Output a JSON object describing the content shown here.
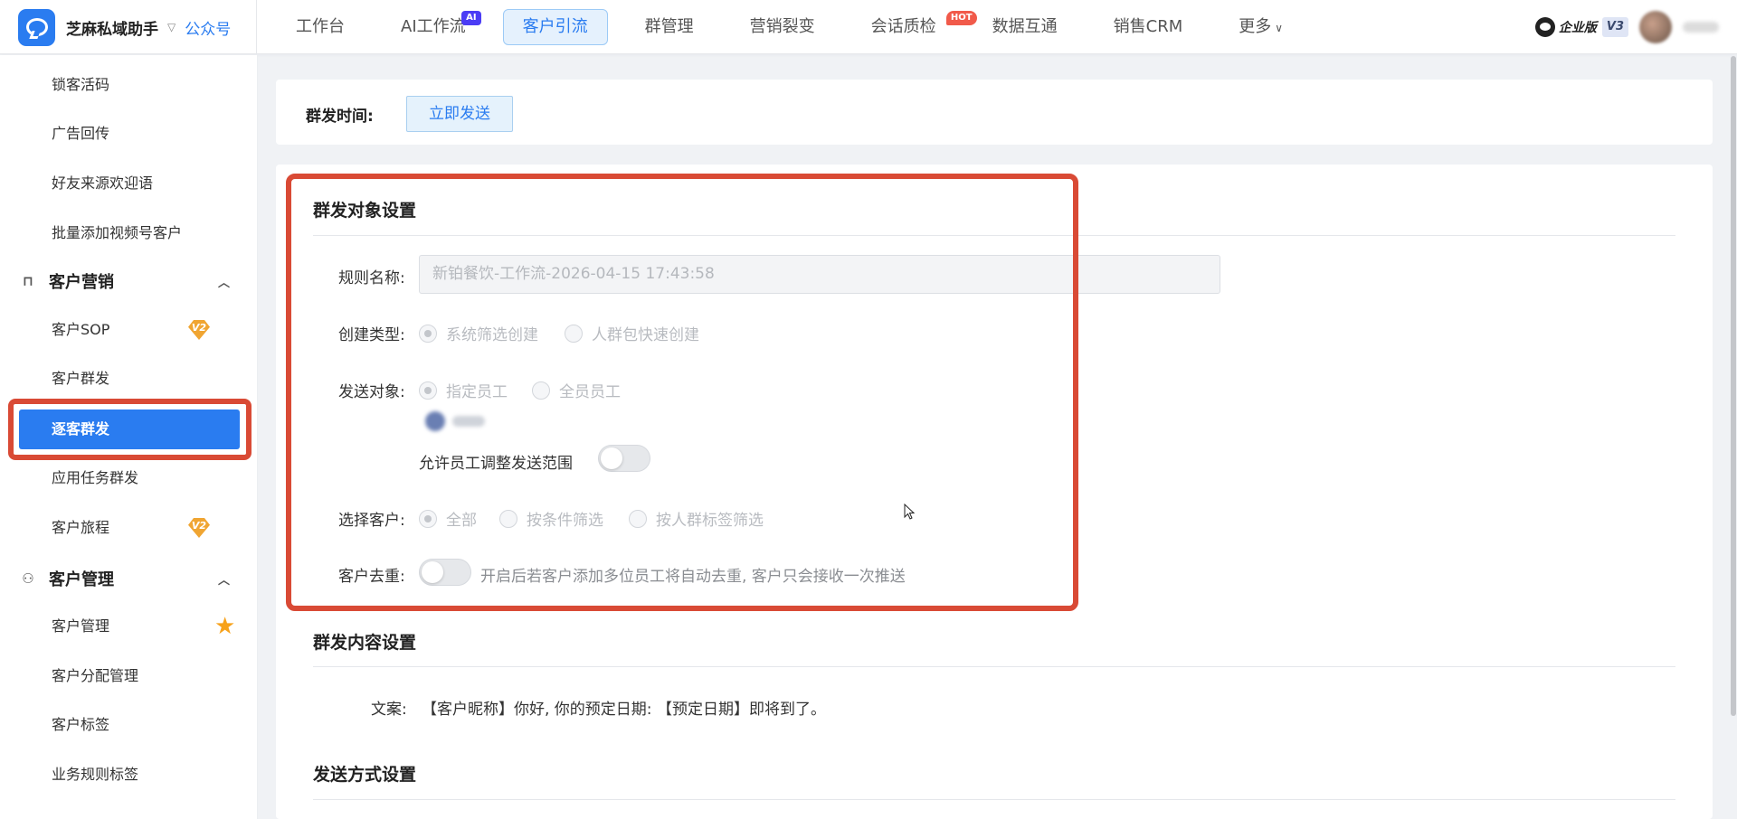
{
  "brand": {
    "name": "芝麻私域助手",
    "sub": "公众号"
  },
  "nav": [
    {
      "label": "工作台",
      "badge": ""
    },
    {
      "label": "AI工作流",
      "badge": "AI"
    },
    {
      "label": "客户引流",
      "badge": ""
    },
    {
      "label": "群管理",
      "badge": ""
    },
    {
      "label": "营销裂变",
      "badge": ""
    },
    {
      "label": "会话质检",
      "badge": "HOT"
    },
    {
      "label": "数据互通",
      "badge": ""
    },
    {
      "label": "销售CRM",
      "badge": ""
    },
    {
      "label": "更多",
      "badge": ""
    }
  ],
  "account": {
    "edition": "企业版",
    "version": "V3"
  },
  "sidebar": {
    "items_top": [
      "锁客活码",
      "广告回传",
      "好友来源欢迎语",
      "批量添加视频号客户"
    ],
    "group_marketing": "客户营销",
    "marketing_items": [
      "客户SOP",
      "客户群发",
      "逐客群发",
      "应用任务群发",
      "客户旅程"
    ],
    "group_manage": "客户管理",
    "manage_items": [
      "客户管理",
      "客户分配管理",
      "客户标签",
      "业务规则标签"
    ],
    "badge_v2": "V2"
  },
  "send_time": {
    "label": "群发时间:",
    "button": "立即发送"
  },
  "target_section": {
    "title": "群发对象设置",
    "rule_name_label": "规则名称:",
    "rule_name_value": "新铂餐饮-工作流-2026-04-15 17:43:58",
    "create_type_label": "创建类型:",
    "create_type_options": [
      "系统筛选创建",
      "人群包快速创建"
    ],
    "send_target_label": "发送对象:",
    "send_target_options": [
      "指定员工",
      "全员员工"
    ],
    "allow_adjust_label": "允许员工调整发送范围",
    "customer_label": "选择客户:",
    "customer_options": [
      "全部",
      "按条件筛选",
      "按人群标签筛选"
    ],
    "dedupe_label": "客户去重:",
    "dedupe_hint": "开启后若客户添加多位员工将自动去重, 客户只会接收一次推送"
  },
  "content_section": {
    "title": "群发内容设置",
    "copy_label": "文案:",
    "copy_value": "【客户昵称】你好, 你的预定日期: 【预定日期】即将到了。"
  },
  "method_section": {
    "title": "发送方式设置"
  },
  "colors": {
    "accent": "#2a7cf0",
    "highlight": "#d94a35",
    "badge_ai": "#4b3cf5",
    "badge_hot": "#f15a4a",
    "badge_v2": "#f0a532"
  }
}
